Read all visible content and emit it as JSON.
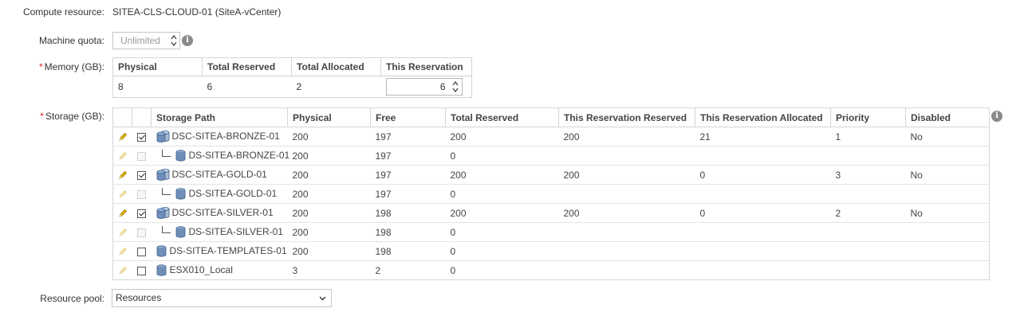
{
  "compute": {
    "label": "Compute resource:",
    "value": "SITEA-CLS-CLOUD-01 (SiteA-vCenter)"
  },
  "quota": {
    "label": "Machine quota:",
    "value": "Unlimited"
  },
  "memory": {
    "label": "Memory (GB):",
    "required_mark": "*",
    "headers": [
      "Physical",
      "Total Reserved",
      "Total Allocated",
      "This Reservation"
    ],
    "physical": "8",
    "total_reserved": "6",
    "total_allocated": "2",
    "this_reservation": "6"
  },
  "storage": {
    "label": "Storage (GB):",
    "required_mark": "*",
    "headers": [
      "",
      "",
      "Storage Path",
      "Physical",
      "Free",
      "Total Reserved",
      "This Reservation Reserved",
      "This Reservation Allocated",
      "Priority",
      "Disabled"
    ],
    "rows": [
      {
        "path": "DSC-SITEA-BRONZE-01",
        "physical": "200",
        "free": "197",
        "total_reserved": "200",
        "res_reserved": "200",
        "res_allocated": "21",
        "priority": "1",
        "disabled": "No"
      },
      {
        "path": "DS-SITEA-BRONZE-01",
        "physical": "200",
        "free": "197",
        "total_reserved": "0",
        "res_reserved": "",
        "res_allocated": "",
        "priority": "",
        "disabled": ""
      },
      {
        "path": "DSC-SITEA-GOLD-01",
        "physical": "200",
        "free": "197",
        "total_reserved": "200",
        "res_reserved": "200",
        "res_allocated": "0",
        "priority": "3",
        "disabled": "No"
      },
      {
        "path": "DS-SITEA-GOLD-01",
        "physical": "200",
        "free": "197",
        "total_reserved": "0",
        "res_reserved": "",
        "res_allocated": "",
        "priority": "",
        "disabled": ""
      },
      {
        "path": "DSC-SITEA-SILVER-01",
        "physical": "200",
        "free": "198",
        "total_reserved": "200",
        "res_reserved": "200",
        "res_allocated": "0",
        "priority": "2",
        "disabled": "No"
      },
      {
        "path": "DS-SITEA-SILVER-01",
        "physical": "200",
        "free": "198",
        "total_reserved": "0",
        "res_reserved": "",
        "res_allocated": "",
        "priority": "",
        "disabled": ""
      },
      {
        "path": "DS-SITEA-TEMPLATES-01",
        "physical": "200",
        "free": "198",
        "total_reserved": "0",
        "res_reserved": "",
        "res_allocated": "",
        "priority": "",
        "disabled": ""
      },
      {
        "path": "ESX010_Local",
        "physical": "3",
        "free": "2",
        "total_reserved": "0",
        "res_reserved": "",
        "res_allocated": "",
        "priority": "",
        "disabled": ""
      }
    ]
  },
  "resource_pool": {
    "label": "Resource pool:",
    "value": "Resources"
  },
  "colors": {
    "required": "#e02020",
    "info": "#8a8a8a",
    "pencil": "#d9a400",
    "db": "#6f8fb8"
  },
  "icons": {
    "info": "info-icon",
    "edit": "pencil-icon",
    "datastore": "database-icon",
    "cluster": "datastore-cluster-icon"
  }
}
